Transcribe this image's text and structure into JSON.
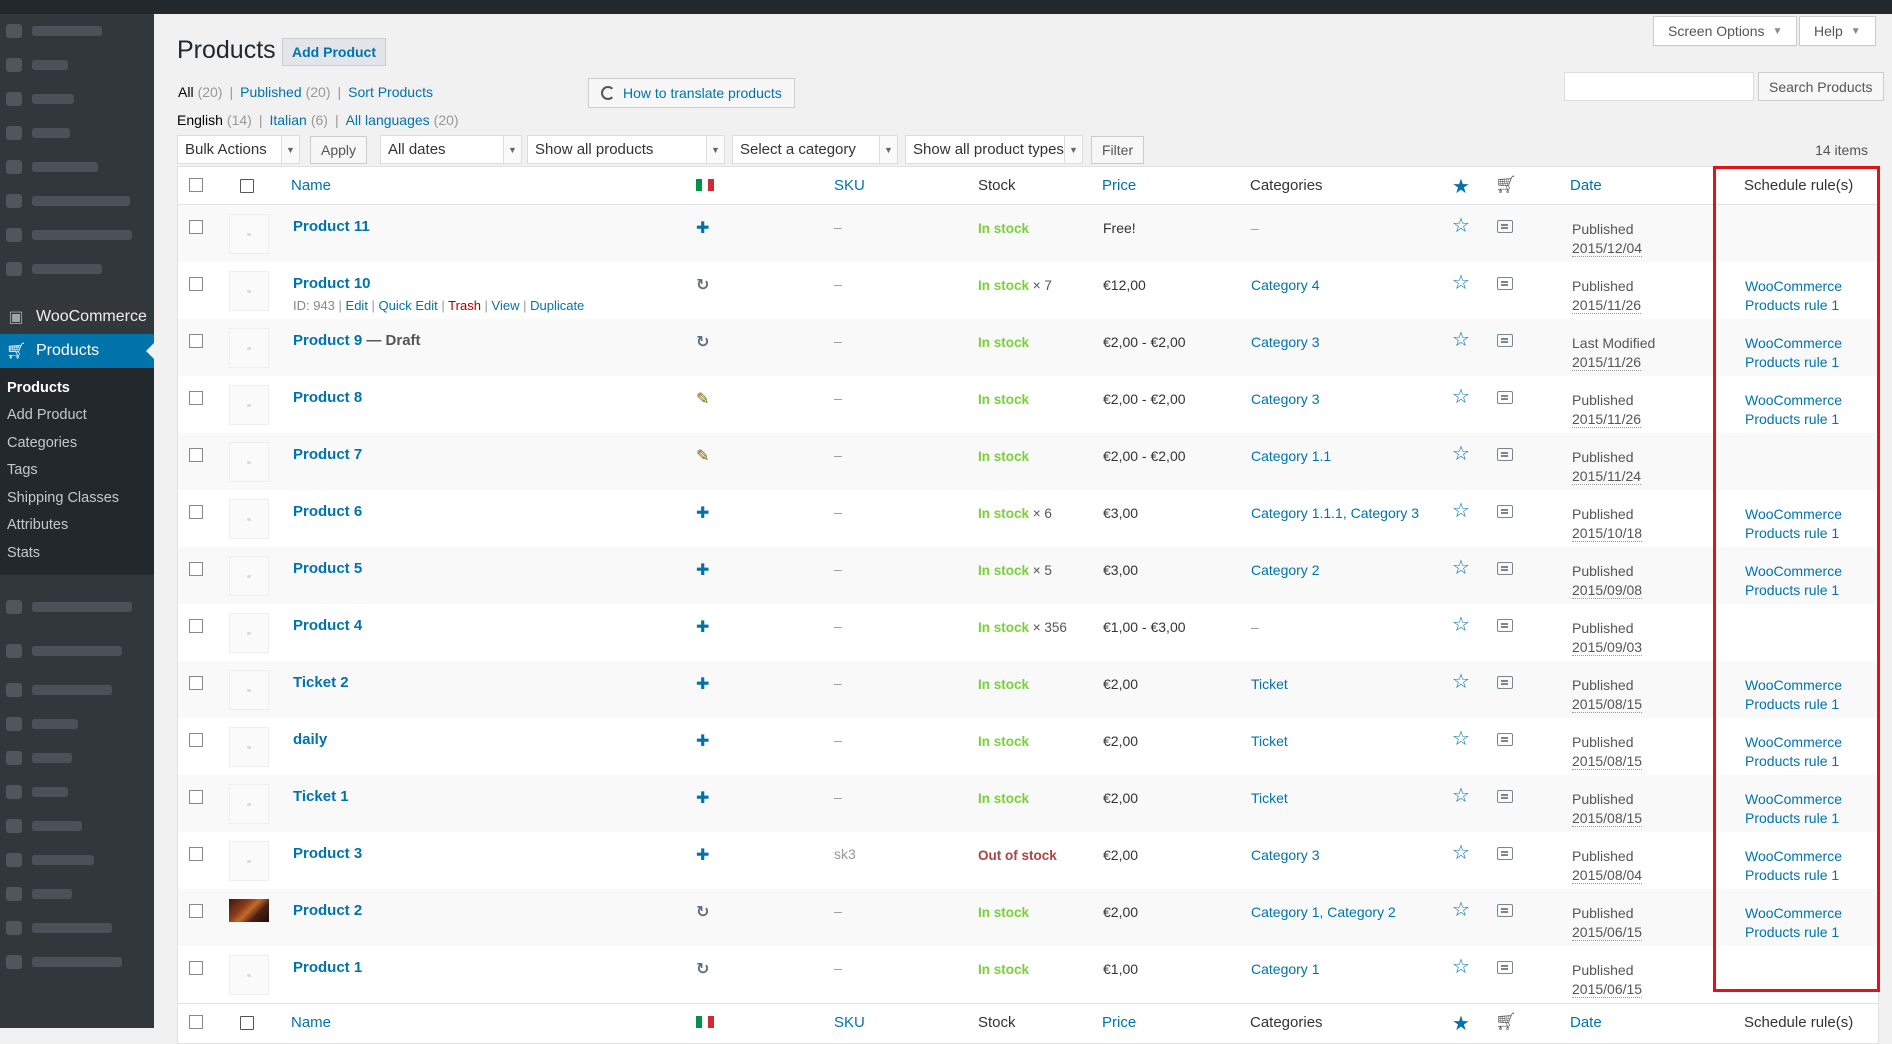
{
  "topbar": {
    "screen_options": "Screen Options",
    "help": "Help"
  },
  "sidebar": {
    "woocommerce": "WooCommerce",
    "products": "Products",
    "submenu": [
      "Products",
      "Add Product",
      "Categories",
      "Tags",
      "Shipping Classes",
      "Attributes",
      "Stats"
    ]
  },
  "header": {
    "title": "Products",
    "add_new": "Add Product"
  },
  "views": {
    "all": "All",
    "all_count": "(20)",
    "published": "Published",
    "published_count": "(20)",
    "sort": "Sort Products",
    "howto": "How to translate products"
  },
  "languages": {
    "english": "English",
    "english_count": "(14)",
    "italian": "Italian",
    "italian_count": "(6)",
    "all": "All languages",
    "all_count": "(20)"
  },
  "search": {
    "button": "Search Products",
    "value": ""
  },
  "filters": {
    "bulk": "Bulk Actions",
    "apply": "Apply",
    "dates": "All dates",
    "products": "Show all products",
    "category": "Select a category",
    "types": "Show all product types",
    "filter": "Filter",
    "items": "14 items"
  },
  "columns": {
    "name": "Name",
    "sku": "SKU",
    "stock": "Stock",
    "price": "Price",
    "categories": "Categories",
    "date": "Date",
    "schedule": "Schedule rule(s)"
  },
  "flag_colors": [
    "#009246",
    "#ffffff",
    "#ce2b37"
  ],
  "rows": [
    {
      "name": "Product 11",
      "lang": "plus",
      "sku": "–",
      "stock": "In stock",
      "qty": "",
      "price": "Free!",
      "cats": "–",
      "status": "Published",
      "date": "2015/12/04",
      "sched1": "",
      "sched2": ""
    },
    {
      "name": "Product 10",
      "lang": "refresh",
      "sku": "–",
      "stock": "In stock",
      "qty": "× 7",
      "price": "€12,00",
      "cats": "Category 4",
      "status": "Published",
      "date": "2015/11/26",
      "sched1": "WooCommerce",
      "sched2": "Products rule 1"
    },
    {
      "name": "Product 9",
      "draft": "— Draft",
      "lang": "refresh",
      "sku": "–",
      "stock": "In stock",
      "qty": "",
      "price": "€2,00 - €2,00",
      "cats": "Category 3",
      "status": "Last Modified",
      "date": "2015/11/26",
      "sched1": "WooCommerce",
      "sched2": "Products rule 1"
    },
    {
      "name": "Product 8",
      "lang": "pencil",
      "sku": "–",
      "stock": "In stock",
      "qty": "",
      "price": "€2,00 - €2,00",
      "cats": "Category 3",
      "status": "Published",
      "date": "2015/11/26",
      "sched1": "WooCommerce",
      "sched2": "Products rule 1"
    },
    {
      "name": "Product 7",
      "lang": "pencil",
      "sku": "–",
      "stock": "In stock",
      "qty": "",
      "price": "€2,00 - €2,00",
      "cats": "Category 1.1",
      "status": "Published",
      "date": "2015/11/24",
      "sched1": "",
      "sched2": ""
    },
    {
      "name": "Product 6",
      "lang": "plus",
      "sku": "–",
      "stock": "In stock",
      "qty": "× 6",
      "price": "€3,00",
      "cats": "Category 1.1.1, Category 3",
      "status": "Published",
      "date": "2015/10/18",
      "sched1": "WooCommerce",
      "sched2": "Products rule 1"
    },
    {
      "name": "Product 5",
      "lang": "plus",
      "sku": "–",
      "stock": "In stock",
      "qty": "× 5",
      "price": "€3,00",
      "cats": "Category 2",
      "status": "Published",
      "date": "2015/09/08",
      "sched1": "WooCommerce",
      "sched2": "Products rule 1"
    },
    {
      "name": "Product 4",
      "lang": "plus",
      "sku": "–",
      "stock": "In stock",
      "qty": "× 356",
      "price": "€1,00 - €3,00",
      "cats": "–",
      "status": "Published",
      "date": "2015/09/03",
      "sched1": "",
      "sched2": ""
    },
    {
      "name": "Ticket 2",
      "lang": "plus",
      "sku": "–",
      "stock": "In stock",
      "qty": "",
      "price": "€2,00",
      "cats": "Ticket",
      "status": "Published",
      "date": "2015/08/15",
      "sched1": "WooCommerce",
      "sched2": "Products rule 1"
    },
    {
      "name": "daily",
      "lang": "plus",
      "sku": "–",
      "stock": "In stock",
      "qty": "",
      "price": "€2,00",
      "cats": "Ticket",
      "status": "Published",
      "date": "2015/08/15",
      "sched1": "WooCommerce",
      "sched2": "Products rule 1"
    },
    {
      "name": "Ticket 1",
      "lang": "plus",
      "sku": "–",
      "stock": "In stock",
      "qty": "",
      "price": "€2,00",
      "cats": "Ticket",
      "status": "Published",
      "date": "2015/08/15",
      "sched1": "WooCommerce",
      "sched2": "Products rule 1"
    },
    {
      "name": "Product 3",
      "lang": "plus",
      "sku": "sk3",
      "stock": "Out of stock",
      "qty": "",
      "price": "€2,00",
      "cats": "Category 3",
      "status": "Published",
      "date": "2015/08/04",
      "sched1": "WooCommerce",
      "sched2": "Products rule 1"
    },
    {
      "name": "Product 2",
      "lang": "refresh",
      "sku": "–",
      "stock": "In stock",
      "qty": "",
      "price": "€2,00",
      "cats": "Category 1, Category 2",
      "status": "Published",
      "date": "2015/06/15",
      "sched1": "WooCommerce",
      "sched2": "Products rule 1"
    },
    {
      "name": "Product 1",
      "lang": "refresh",
      "sku": "–",
      "stock": "In stock",
      "qty": "",
      "price": "€1,00",
      "cats": "Category 1",
      "status": "Published",
      "date": "2015/06/15",
      "sched1": "",
      "sched2": ""
    }
  ],
  "row_actions": {
    "id": "ID: 943",
    "edit": "Edit",
    "quick_edit": "Quick Edit",
    "trash": "Trash",
    "view": "View",
    "duplicate": "Duplicate"
  }
}
